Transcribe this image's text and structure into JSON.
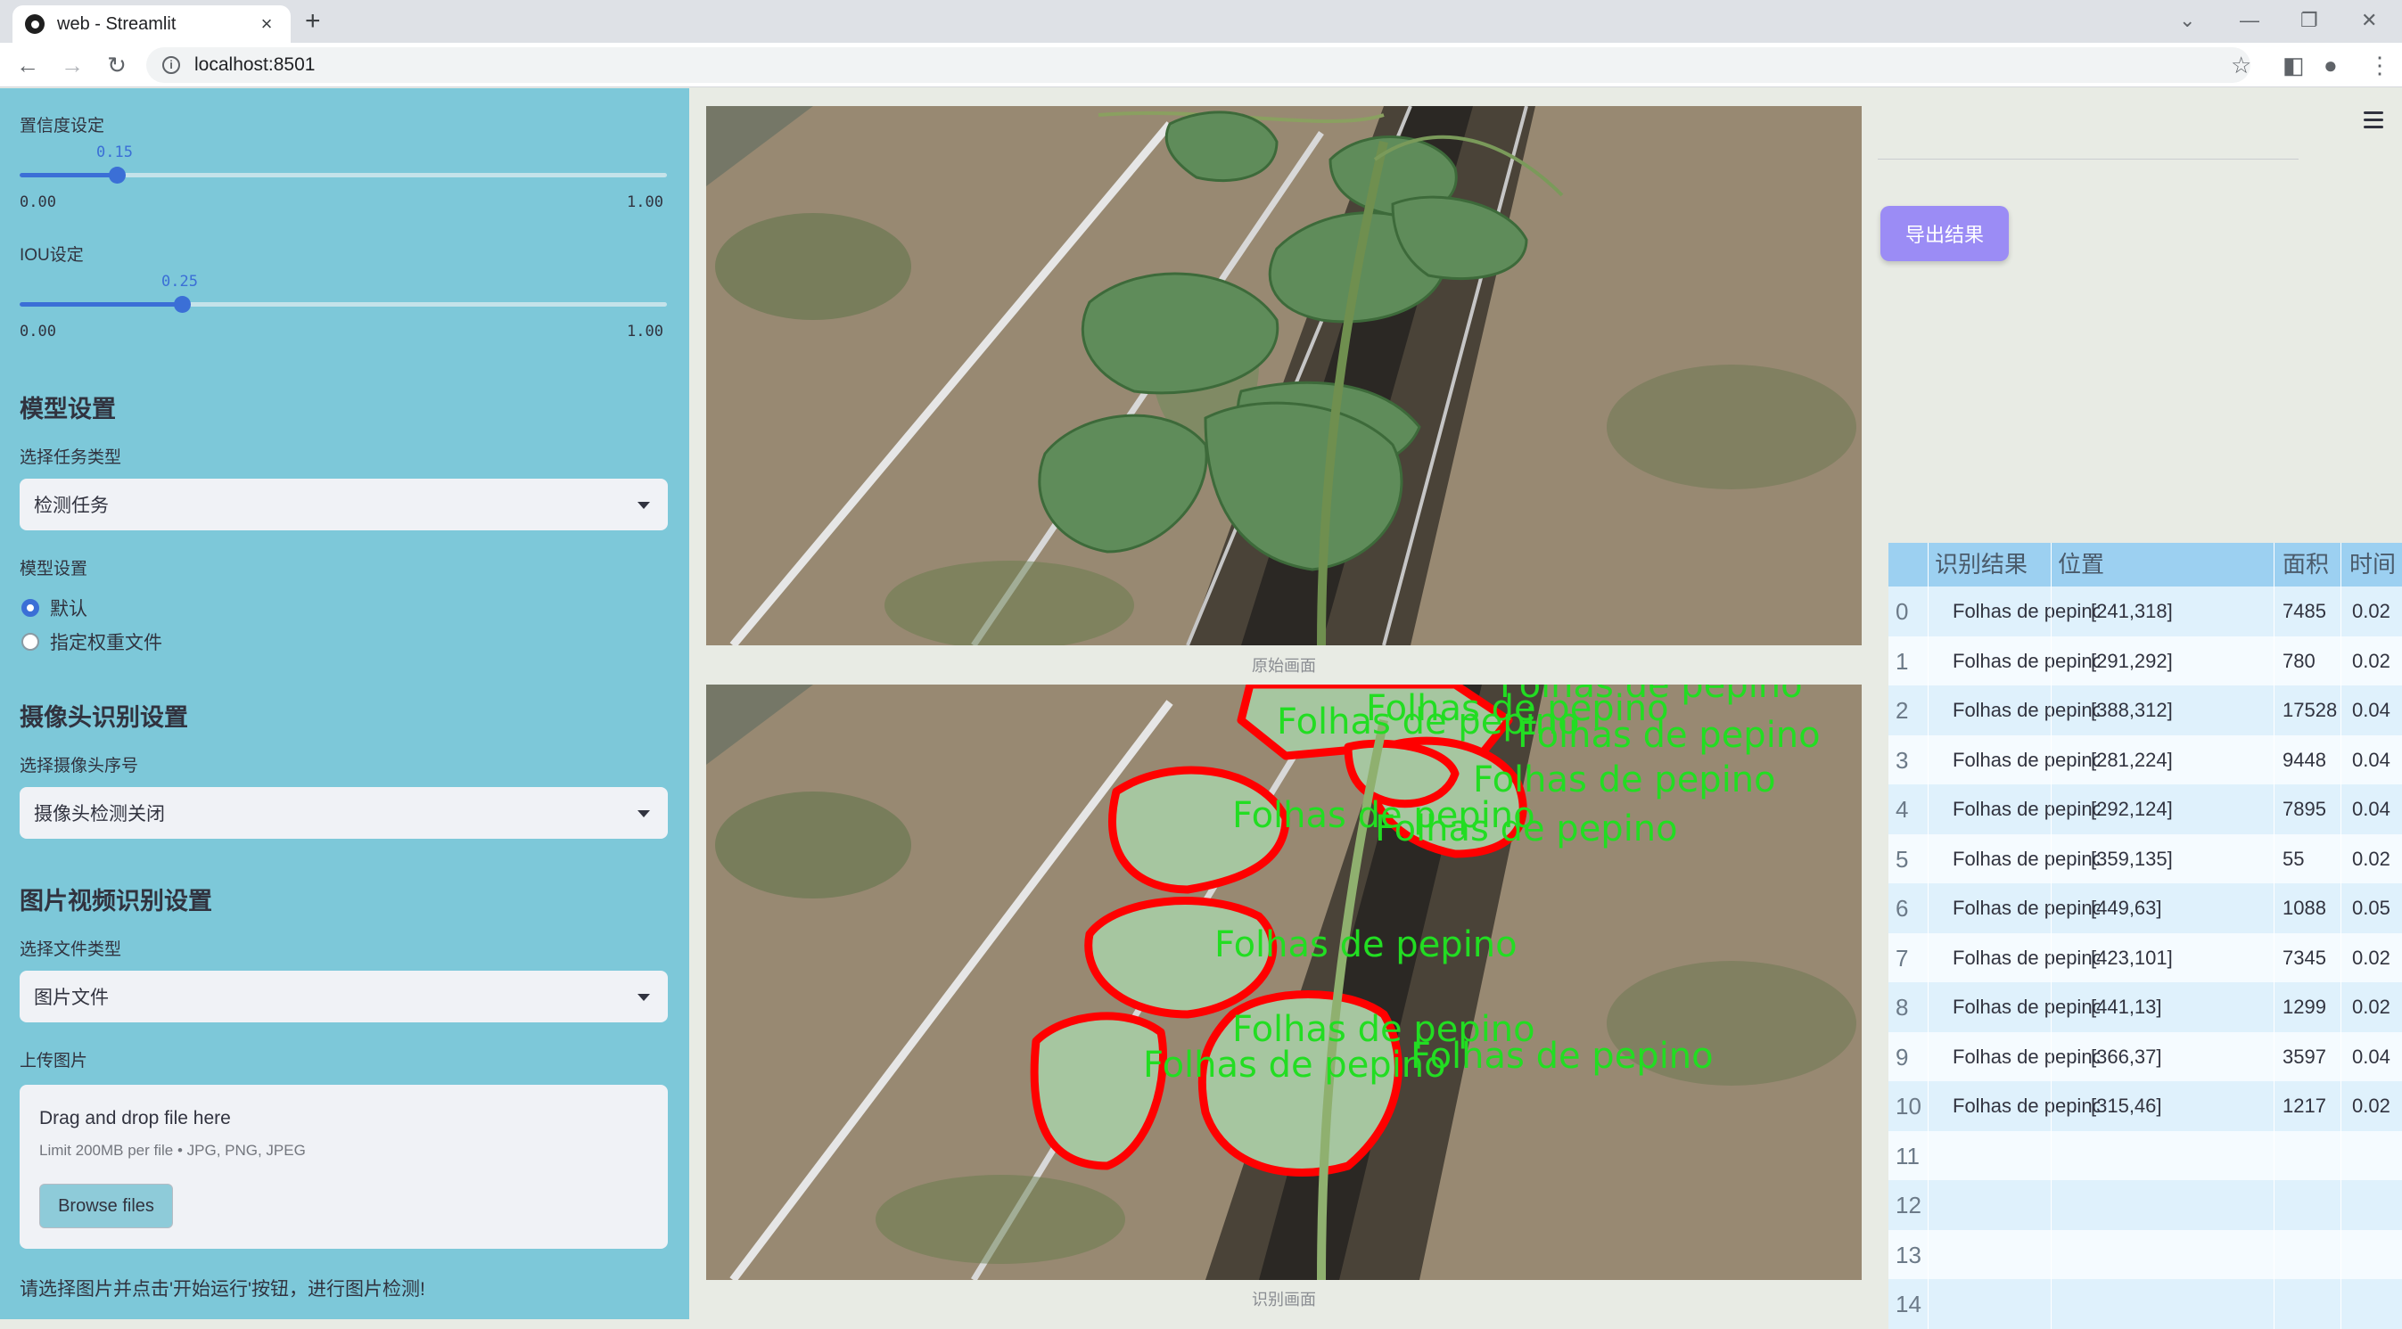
{
  "browser": {
    "tab_title": "web - Streamlit",
    "url": "localhost:8501"
  },
  "sidebar": {
    "confidence": {
      "label": "置信度设定",
      "value": "0.15",
      "min": "0.00",
      "max": "1.00",
      "fraction": 0.15
    },
    "iou": {
      "label": "IOU设定",
      "value": "0.25",
      "min": "0.00",
      "max": "1.00",
      "fraction": 0.25
    },
    "model_section": "模型设置",
    "task_label": "选择任务类型",
    "task_value": "检测任务",
    "model_label": "模型设置",
    "model_options": [
      "默认",
      "指定权重文件"
    ],
    "model_selected": 0,
    "camera_section": "摄像头识别设置",
    "camera_label": "选择摄像头序号",
    "camera_value": "摄像头检测关闭",
    "media_section": "图片视频识别设置",
    "filetype_label": "选择文件类型",
    "filetype_value": "图片文件",
    "upload_label": "上传图片",
    "upload_title": "Drag and drop file here",
    "upload_limit": "Limit 200MB per file • JPG, PNG, JPEG",
    "browse_label": "Browse files",
    "hint": "请选择图片并点击'开始运行'按钮，进行图片检测!"
  },
  "main": {
    "caption_original": "原始画面",
    "caption_result": "识别画面",
    "export_label": "导出结果",
    "detection_label": "Folhas de pepino",
    "colors": {
      "mask": "#ff0000",
      "label": "#22dd22",
      "accent": "#9b8cf5",
      "header": "#9cd0f1"
    }
  },
  "table": {
    "headers": [
      "识别结果",
      "位置",
      "面积",
      "时间"
    ],
    "rows": [
      {
        "idx": "0",
        "result": "Folhas de pepino",
        "pos": "[241,318]",
        "area": "7485",
        "time": "0.02"
      },
      {
        "idx": "1",
        "result": "Folhas de pepino",
        "pos": "[291,292]",
        "area": "780",
        "time": "0.02"
      },
      {
        "idx": "2",
        "result": "Folhas de pepino",
        "pos": "[388,312]",
        "area": "17528",
        "time": "0.04"
      },
      {
        "idx": "3",
        "result": "Folhas de pepino",
        "pos": "[281,224]",
        "area": "9448",
        "time": "0.04"
      },
      {
        "idx": "4",
        "result": "Folhas de pepino",
        "pos": "[292,124]",
        "area": "7895",
        "time": "0.04"
      },
      {
        "idx": "5",
        "result": "Folhas de pepino",
        "pos": "[359,135]",
        "area": "55",
        "time": "0.02"
      },
      {
        "idx": "6",
        "result": "Folhas de pepino",
        "pos": "[449,63]",
        "area": "1088",
        "time": "0.05"
      },
      {
        "idx": "7",
        "result": "Folhas de pepino",
        "pos": "[423,101]",
        "area": "7345",
        "time": "0.02"
      },
      {
        "idx": "8",
        "result": "Folhas de pepino",
        "pos": "[441,13]",
        "area": "1299",
        "time": "0.02"
      },
      {
        "idx": "9",
        "result": "Folhas de pepino",
        "pos": "[366,37]",
        "area": "3597",
        "time": "0.04"
      },
      {
        "idx": "10",
        "result": "Folhas de pepino",
        "pos": "[315,46]",
        "area": "1217",
        "time": "0.02"
      },
      {
        "idx": "11",
        "result": "",
        "pos": "",
        "area": "",
        "time": ""
      },
      {
        "idx": "12",
        "result": "",
        "pos": "",
        "area": "",
        "time": ""
      },
      {
        "idx": "13",
        "result": "",
        "pos": "",
        "area": "",
        "time": ""
      },
      {
        "idx": "14",
        "result": "",
        "pos": "",
        "area": "",
        "time": ""
      }
    ]
  }
}
